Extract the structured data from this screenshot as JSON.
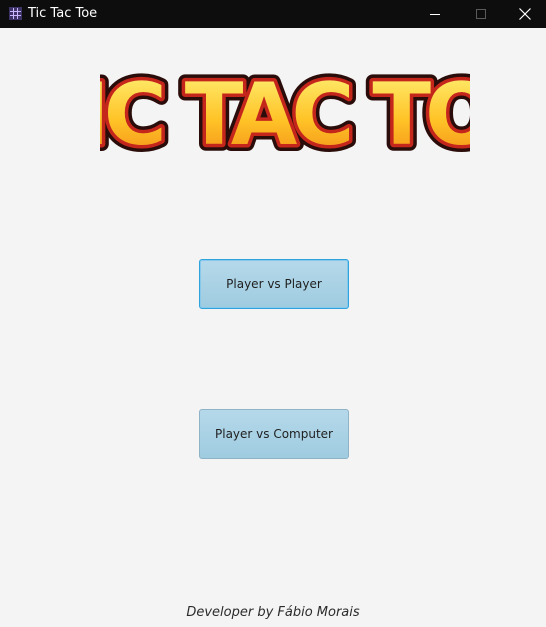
{
  "window": {
    "title": "Tic Tac Toe",
    "icon": "tic-tac-toe-app-icon",
    "controls": {
      "minimize_icon": "minimize-icon",
      "maximize_icon": "maximize-icon",
      "close_icon": "close-icon"
    }
  },
  "logo": {
    "text": "TIC TAC TOE",
    "colors": {
      "fill_top": "#fff37a",
      "fill_bottom": "#f28a16",
      "outline": "#c4261c",
      "shadow": "#2a0d0a"
    }
  },
  "buttons": {
    "player_vs_player": "Player vs Player",
    "player_vs_computer": "Player vs Computer"
  },
  "footer": {
    "credit": "Developer by Fábio Morais"
  },
  "colors": {
    "titlebar": "#0d0d0d",
    "background": "#f4f4f4",
    "button_fill": "#a9d3e7",
    "button_focus_border": "#2ea3dc"
  }
}
